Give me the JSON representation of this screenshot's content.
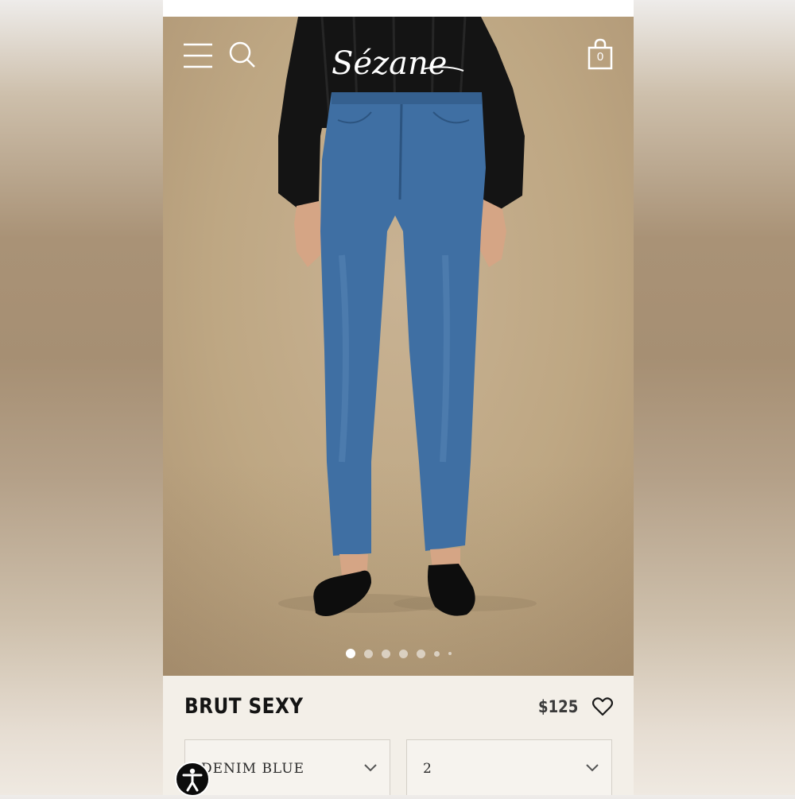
{
  "header": {
    "logo_text": "Sézane",
    "menu_icon": "hamburger-menu-icon",
    "search_icon": "search-icon",
    "cart_icon": "shopping-bag-icon",
    "cart_count": "0"
  },
  "gallery": {
    "image_count": 7,
    "active_index": 0
  },
  "product": {
    "name": "BRUT SEXY",
    "price": "$125",
    "wishlist_icon": "heart-icon"
  },
  "options": {
    "color": {
      "value": "DENIM BLUE"
    },
    "size": {
      "value": "2"
    }
  },
  "accessibility": {
    "icon": "accessibility-icon"
  },
  "colors": {
    "brand_text": "#141414",
    "background": "#f3efe8",
    "denim": "#3f6fa3"
  }
}
